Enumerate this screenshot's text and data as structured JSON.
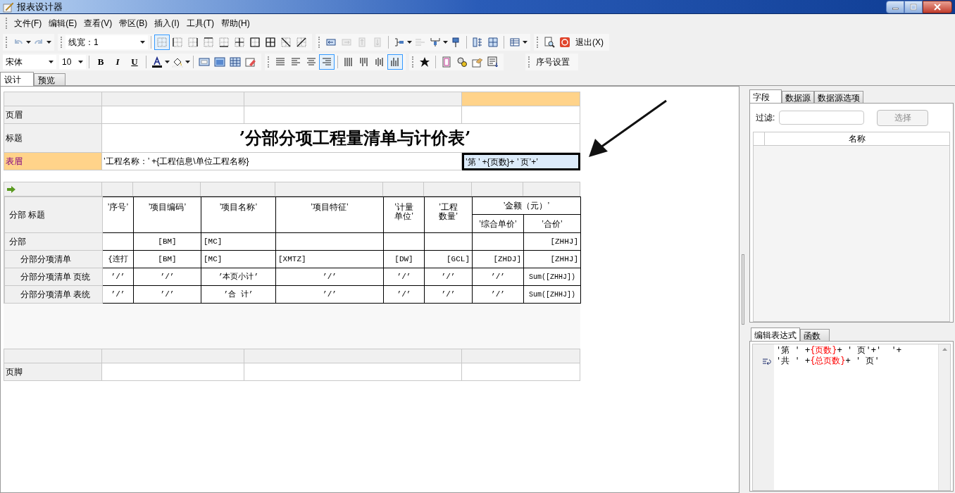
{
  "window": {
    "title": "报表设计器"
  },
  "menu": [
    "文件(F)",
    "编辑(E)",
    "查看(V)",
    "带区(B)",
    "插入(I)",
    "工具(T)",
    "帮助(H)"
  ],
  "toolbar1": {
    "line_width": "线宽：1",
    "border_buttons": [
      {
        "selected": true
      },
      {
        "selected": false
      },
      {
        "selected": false
      },
      {
        "selected": false
      },
      {
        "selected": false
      },
      {
        "selected": false
      },
      {
        "selected": false
      },
      {
        "selected": false
      },
      {
        "selected": false
      },
      {
        "selected": false
      }
    ],
    "exit_label": "退出(X)"
  },
  "toolbar2": {
    "font": "宋体",
    "size": "10",
    "format_buttons": [
      "B",
      "I",
      "U"
    ],
    "align_buttons": [
      {
        "selected": false
      },
      {
        "selected": false
      },
      {
        "selected": false
      },
      {
        "selected": true
      }
    ],
    "valign_buttons": [
      {
        "selected": false
      },
      {
        "selected": false
      },
      {
        "selected": false
      },
      {
        "selected": true
      }
    ],
    "numbering_button": "序号设置"
  },
  "tabs": [
    {
      "label": "设计",
      "selected": true
    },
    {
      "label": "预览",
      "selected": false
    }
  ],
  "report": {
    "top_columns": [
      {
        "selected": false
      },
      {
        "selected": false
      },
      {
        "selected": true
      }
    ],
    "top_bands": [
      {
        "label": "页眉",
        "selected": false,
        "kind": "empty"
      },
      {
        "label": "标题",
        "selected": false,
        "kind": "title",
        "text": "’分部分项工程量清单与计价表’"
      },
      {
        "label": "表眉",
        "selected": true,
        "kind": "fields",
        "cells": [
          {
            "text": "’工程名称：’ +{工程信息\\单位工程名称}",
            "selected": false
          },
          {
            "text": "’第 ’ +{页数}+ ’ 页’+’",
            "selected": true
          }
        ]
      }
    ],
    "detail_header_label": "分部 标题",
    "detail_headers": [
      {
        "lines": [
          "’序号’"
        ]
      },
      {
        "lines": [
          "’项目编码’"
        ]
      },
      {
        "lines": [
          "’项目名称’"
        ]
      },
      {
        "lines": [
          "’项目特征’"
        ]
      },
      {
        "lines": [
          "’计量",
          "单位’"
        ]
      },
      {
        "lines": [
          "’工程",
          "数量’"
        ]
      }
    ],
    "group_header": {
      "text": "’金额（元）’",
      "sub_headers": [
        "’综合单价’",
        "’合价’"
      ]
    },
    "detail_rows": [
      {
        "label": "分部",
        "kind": "data",
        "cells": [
          null,
          "[BM]",
          "[MC]",
          null,
          null,
          null,
          null,
          "[ZHHJ]"
        ],
        "children": [
          {
            "label": "分部分项清单",
            "kind": "data",
            "cells": [
              "{连打",
              "[BM]",
              "[MC]",
              "[XMTZ]",
              "[DW]",
              "[GCL]",
              "[ZHDJ]",
              "[ZHHJ]"
            ]
          },
          {
            "label": "分部分项清单 页统",
            "kind": "summary",
            "cells": [
              "’/’",
              "’/’",
              "’本页小计’",
              "’/’",
              "’/’",
              "’/’",
              "’/’",
              "Sum([ZHHJ])"
            ]
          },
          {
            "label": "分部分项清单 表统",
            "kind": "summary",
            "cells": [
              "’/’",
              "’/’",
              "’合    计’",
              "’/’",
              "’/’",
              "’/’",
              "’/’",
              "Sum([ZHHJ])"
            ]
          }
        ]
      }
    ],
    "footer_band": {
      "label": "页脚"
    }
  },
  "right_panel": {
    "tabs": [
      {
        "label": "字段",
        "selected": true
      },
      {
        "label": "数据源",
        "selected": false
      },
      {
        "label": "数据源选项",
        "selected": false
      }
    ],
    "filter_label": "过滤:",
    "select_button": {
      "label": "选择",
      "disabled": true
    },
    "field_table": {
      "columns": [
        "名称"
      ]
    },
    "editor_tabs": [
      {
        "label": "编辑表达式",
        "selected": true
      },
      {
        "label": "函数",
        "selected": false
      }
    ],
    "expression": [
      [
        {
          "text": "'第 ' +",
          "kind": "literal"
        },
        {
          "text": "{页数}",
          "kind": "field"
        },
        {
          "text": "+ ' 页'+'  '+",
          "kind": "literal"
        }
      ],
      [
        {
          "text": "'共 ' +",
          "kind": "literal"
        },
        {
          "text": "{总页数}",
          "kind": "field"
        },
        {
          "text": "+ ' 页'",
          "kind": "literal"
        }
      ]
    ]
  }
}
